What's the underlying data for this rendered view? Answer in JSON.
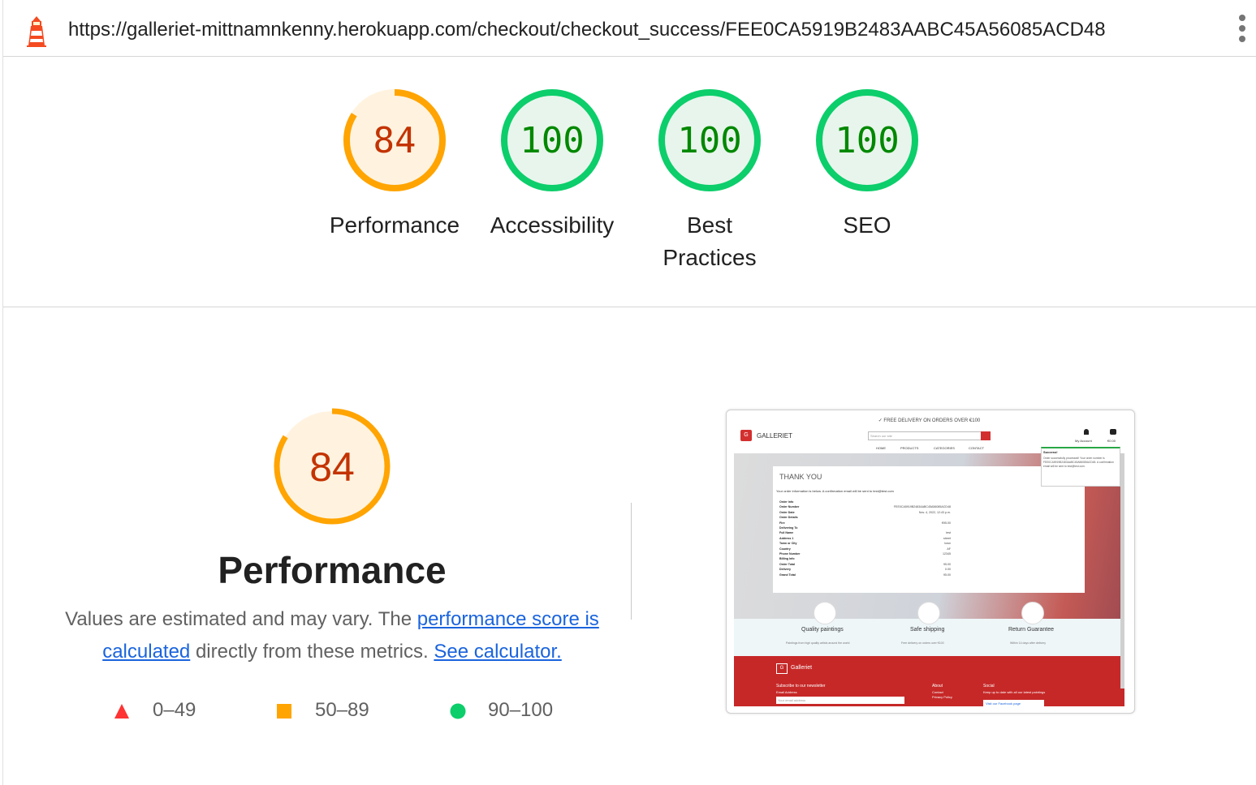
{
  "address_bar": {
    "url": "https://galleriet-mittnamnkenny.herokuapp.com/checkout/checkout_success/FEE0CA5919B2483AABC45A56085ACD48",
    "logo_icon": "lighthouse-icon",
    "menu_icon": "kebab-menu-icon"
  },
  "colors": {
    "average": "#ffa400",
    "average_text": "#c33300",
    "average_fill": "#fff3e0",
    "pass": "#0cce6b",
    "pass_text": "#008800",
    "pass_fill": "#e8f5ec",
    "fail": "#ff3333",
    "link": "#1a64de"
  },
  "summary": {
    "gauges": [
      {
        "label": "Performance",
        "score": "84"
      },
      {
        "label": "Accessibility",
        "score": "100"
      },
      {
        "label": "Best Practices",
        "score": "100"
      },
      {
        "label": "SEO",
        "score": "100"
      }
    ]
  },
  "performance": {
    "score": "84",
    "title": "Performance",
    "desc_prefix": "Values are estimated and may vary. The ",
    "link_score": "performance score is calculated",
    "desc_middle": " directly from these metrics. ",
    "link_calc": "See calculator.",
    "legend": [
      {
        "icon": "fail-triangle-icon",
        "range": "0–49"
      },
      {
        "icon": "average-square-icon",
        "range": "50–89"
      },
      {
        "icon": "pass-circle-icon",
        "range": "90–100"
      }
    ]
  },
  "screenshot": {
    "banner": "✓ FREE DELIVERY ON ORDERS OVER €100",
    "logo_mark": "G",
    "brand": "GALLERIET",
    "search_placeholder": "Search our site",
    "nav": [
      "HOME",
      "PRODUCTS",
      "CATEGORIES",
      "CONTACT"
    ],
    "account": "My Account",
    "cart_total": "€0.00",
    "thank_you": "THANK YOU",
    "confirmation": "Your order information is below. A confirmation email will be sent to test@test.com",
    "rows": [
      {
        "label": "Order Info",
        "value": ""
      },
      {
        "label": "Order Number",
        "value": "FEE0CA5919B2483AABC45A56085ACD48"
      },
      {
        "label": "Order Date",
        "value": "Nov. 4, 2022, 12:43 p.m."
      },
      {
        "label": "Order Details",
        "value": ""
      },
      {
        "label": "Fire",
        "value": "€95.00"
      },
      {
        "label": "Delivering To",
        "value": ""
      },
      {
        "label": "Full Name",
        "value": "test"
      },
      {
        "label": "Address 1",
        "value": "street"
      },
      {
        "label": "Town or City",
        "value": "town"
      },
      {
        "label": "Country",
        "value": "AF"
      },
      {
        "label": "Phone Number",
        "value": "12345"
      },
      {
        "label": "Billing Info",
        "value": ""
      },
      {
        "label": "Order Total",
        "value": "95.00"
      },
      {
        "label": "Delivery",
        "value": "0.00"
      },
      {
        "label": "Grand Total",
        "value": "95.00"
      }
    ],
    "toast_title": "Success!",
    "toast_text": "Order successfully processed! Your order number is FEE0CA5919B2483AABC45A56085ACD48. A confirmation email will be sent to test@test.com.",
    "features": [
      {
        "label": "Quality paintings",
        "sub": "Paintings from high quality artists around the world",
        "icon": "palette-icon"
      },
      {
        "label": "Safe shipping",
        "sub": "Free delivery on orders over €100",
        "icon": "truck-icon"
      },
      {
        "label": "Return Guarantee",
        "sub": "Within 14 days after delivery",
        "icon": "return-icon"
      }
    ],
    "footer_brand": "Galleriet",
    "newsletter": "Subscribe to our newsletter",
    "email_label": "Email Address",
    "email_placeholder": "Your email address",
    "about": "About",
    "contact": "Contact",
    "privacy": "Privacy Policy",
    "social": "Social",
    "social_text": "Keep up to date with all our latest paintings",
    "facebook": "Visit our Facebook page"
  }
}
